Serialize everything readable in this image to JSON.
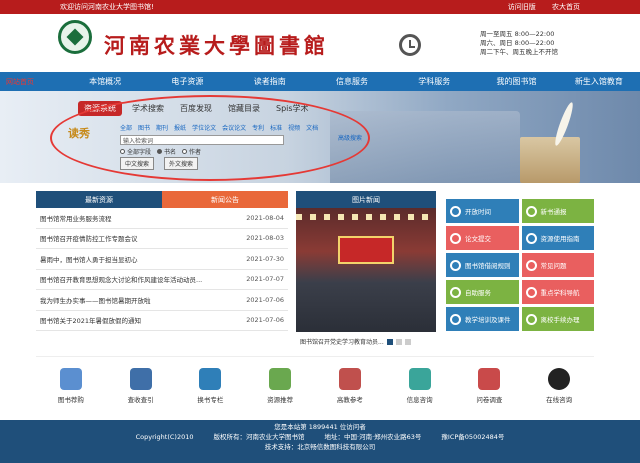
{
  "topbar": {
    "welcome": "欢迎访问河南农业大学图书馆!",
    "link1": "访问旧版",
    "link2": "农大首页"
  },
  "header": {
    "logo_text": "河南农業大學圖書館",
    "hours1": "周一至周五 8:00—22:00",
    "hours2": "周六、周日 8:00—22:00",
    "hours3": "周二下午、周五晚上不开馆"
  },
  "nav": {
    "brand": "网站首页",
    "items": [
      "本馆概况",
      "电子资源",
      "读者指南",
      "信息服务",
      "学科服务",
      "我的图书馆",
      "新生入馆教育"
    ]
  },
  "banner": {
    "tabs": [
      "资源系统",
      "学术搜索",
      "百度发现",
      "馆藏目录",
      "Spis学术"
    ],
    "duxiu": "读秀",
    "cats": [
      "全部",
      "图书",
      "期刊",
      "报纸",
      "学位论文",
      "会议论文",
      "专利",
      "标准",
      "视频",
      "文档"
    ],
    "search_placeholder": "输入检索词",
    "radios": [
      "全部字段",
      "书名",
      "作者"
    ],
    "btn_cn": "中文搜索",
    "btn_en": "外文搜索",
    "adv": "高级搜索"
  },
  "news": {
    "tab1": "最新资源",
    "tab2": "新闻公告",
    "rows": [
      {
        "title": "图书馆常用业务服务流程",
        "date": "2021-08-04"
      },
      {
        "title": "图书馆召开疫情防控工作专题会议",
        "date": "2021-08-03"
      },
      {
        "title": "暑雨中，图书馆人勇于担当显初心",
        "date": "2021-07-30"
      },
      {
        "title": "图书馆召开教育思想观念大讨论和作风建设年活动动员...",
        "date": "2021-07-07"
      },
      {
        "title": "我为师生办实事——图书馆暑期开放啦",
        "date": "2021-07-06"
      },
      {
        "title": "图书馆关于2021年暑假放假的通知",
        "date": "2021-07-06"
      }
    ]
  },
  "pic": {
    "head": "图片新闻",
    "caption": "图书馆召开党史学习教育动员..."
  },
  "tiles": [
    "开放时间",
    "新书通报",
    "论文提交",
    "资源使用指南",
    "图书馆借阅规则",
    "常见问题",
    "自助服务",
    "重点学科导航",
    "教学培训及课件",
    "离校手续办理"
  ],
  "quick": [
    "图书荐购",
    "查收查引",
    "换书专栏",
    "资源推荐",
    "高教参考",
    "信息咨询",
    "问卷调查",
    "在线咨询"
  ],
  "footer": {
    "visits": "您是本站第 1899441 位访问者",
    "copyright": "Copyright(C)2010",
    "owner": "版权所有：河南农业大学图书馆",
    "address": "地址：中国·河南·郑州农业路63号",
    "icp": "豫ICP备05002484号",
    "support": "技术支持：北京畅信数图科技有限公司"
  },
  "colors": {
    "red": "#b71c1c",
    "navy": "#1f4f7a",
    "blue": "#1e6fb3",
    "orange": "#e9683a"
  }
}
